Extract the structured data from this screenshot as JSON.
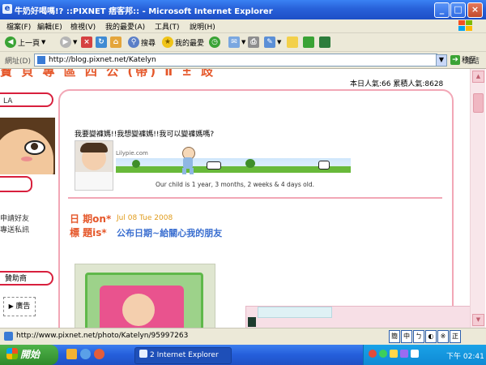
{
  "window": {
    "title": "牛奶好喝嗎!? ::PIXNET 痞客邦:: - Microsoft Internet Explorer"
  },
  "menu": [
    "檔案(F)",
    "編輯(E)",
    "檢視(V)",
    "我的最愛(A)",
    "工具(T)",
    "說明(H)"
  ],
  "toolbar": {
    "back": "上一頁",
    "search": "搜尋",
    "favorites": "我的最愛"
  },
  "address": {
    "label": "網址(D)",
    "url": "http://blog.pixnet.net/Katelyn",
    "go": "移至",
    "links": "連結"
  },
  "page": {
    "header_partial": "寶 貝 專  區 四 公  (帶)  Ⅱ ± 歧",
    "visitors": "本日人氣:66 累積人氣:8628",
    "sidebar": {
      "top_label": "LA",
      "links": [
        "申請好友",
        "專送私訊"
      ],
      "bottom_label": "贊助商",
      "ad": "廣告"
    },
    "post_intro": "我要變褲媽!!我想變褲媽!!我可以變褲媽嗎?",
    "lilypie": {
      "brand": "Lilypie.com",
      "ticker_text": "Our child is 1 year, 3 months, 2 weeks & 4 days old."
    },
    "date_label": "日 期on*",
    "date_value": "Jul 08 Tue 2008",
    "title_label": "標 題is*",
    "title_value": "公布日期~給關心我的朋友"
  },
  "statusbar": {
    "url": "http://www.pixnet.net/photo/Katelyn/95997263"
  },
  "ime": [
    "簡",
    "中",
    "ㄅ",
    "◐",
    "※",
    "正"
  ],
  "taskbar": {
    "start": "開始",
    "task": "2 Internet Explorer",
    "clock": "下午 02:41"
  },
  "colors": {
    "pink": "#f2a7b6",
    "accent_red": "#d8203d",
    "title_orange": "#e5572a",
    "title_blue": "#3b6fd0"
  }
}
